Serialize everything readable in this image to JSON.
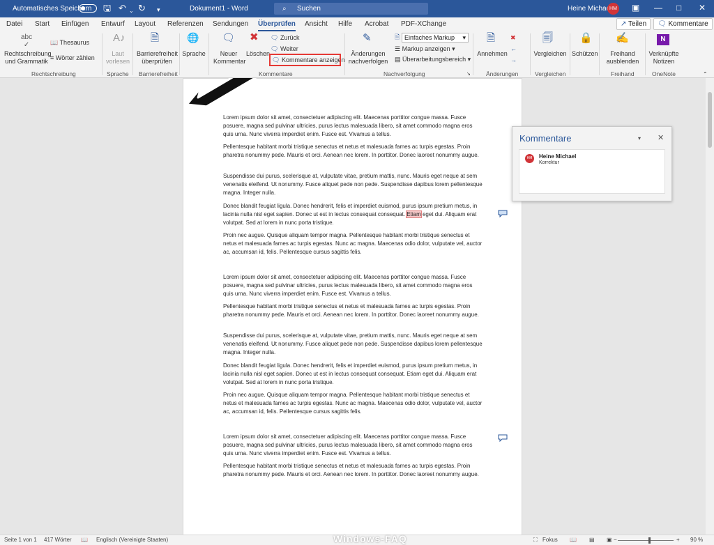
{
  "titlebar": {
    "autosave_label": "Automatisches Speichern",
    "doc_title": "Dokument1  -  Word",
    "search_label": "Suchen",
    "user_name": "Heine Michael",
    "user_initials": "HM"
  },
  "tabs": [
    "Datei",
    "Start",
    "Einfügen",
    "Entwurf",
    "Layout",
    "Referenzen",
    "Sendungen",
    "Überprüfen",
    "Ansicht",
    "Hilfe",
    "Acrobat",
    "PDF-XChange"
  ],
  "active_tab": "Überprüfen",
  "top_buttons": {
    "share": "Teilen",
    "comments": "Kommentare"
  },
  "ribbon": {
    "spelling": "Rechtschreibung\nund Grammatik",
    "thesaurus": "Thesaurus",
    "wordcount": "Wörter zählen",
    "group_proofing": "Rechtschreibung",
    "read_aloud": "Laut\nvorlesen",
    "group_speech": "Sprache",
    "accessibility": "Barrierefreiheit\nüberprüfen",
    "group_accessibility": "Barrierefreiheit",
    "language": "Sprache",
    "group_language": "",
    "new_comment": "Neuer\nKommentar",
    "delete": "Löschen",
    "previous": "Zurück",
    "next": "Weiter",
    "show_comments": "Kommentare anzeigen",
    "group_comments": "Kommentare",
    "track_changes": "Änderungen\nnachverfolgen",
    "markup_combo": "Einfaches Markup",
    "show_markup": "Markup anzeigen",
    "reviewing_pane": "Überarbeitungsbereich",
    "group_tracking": "Nachverfolgung",
    "accept": "Annehmen",
    "group_changes": "Änderungen",
    "compare": "Vergleichen",
    "group_compare": "Vergleichen",
    "protect": "Schützen",
    "hide_ink": "Freihand\nausblenden",
    "group_ink": "Freihand",
    "linked_notes": "Verknüpfte\nNotizen",
    "group_onenote": "OneNote"
  },
  "document": {
    "paragraphs": [
      "Lorem ipsum dolor sit amet, consectetuer adipiscing elit. Maecenas porttitor congue massa. Fusce posuere, magna sed pulvinar ultricies, purus lectus malesuada libero, sit amet commodo magna eros quis urna. Nunc viverra imperdiet enim. Fusce est. Vivamus a tellus.",
      "Pellentesque habitant morbi tristique senectus et netus et malesuada fames ac turpis egestas. Proin pharetra nonummy pede. Mauris et orci. Aenean nec lorem. In porttitor. Donec laoreet nonummy augue.",
      "Suspendisse dui purus, scelerisque at, vulputate vitae, pretium mattis, nunc. Mauris eget neque at sem venenatis eleifend. Ut nonummy. Fusce aliquet pede non pede. Suspendisse dapibus lorem pellentesque magna. Integer nulla.",
      "Donec blandit feugiat ligula. Donec hendrerit, felis et imperdiet euismod, purus ipsum pretium metus, in lacinia nulla nisl eget sapien. Donec ut est in lectus consequat consequat. Etiam eget dui. Aliquam erat volutpat. Sed at lorem in nunc porta tristique.",
      "Proin nec augue. Quisque aliquam tempor magna. Pellentesque habitant morbi tristique senectus et netus et malesuada fames ac turpis egestas. Nunc ac magna. Maecenas odio dolor, vulputate vel, auctor ac, accumsan id, felis. Pellentesque cursus sagittis felis."
    ],
    "highlight_word": "Etiam"
  },
  "comments_panel": {
    "title": "Kommentare",
    "author": "Heine Michael",
    "author_initials": "HM",
    "text": "Korrektur"
  },
  "status": {
    "page": "Seite 1 von 1",
    "words": "417 Wörter",
    "language": "Englisch (Vereinigte Staaten)",
    "focus": "Fokus",
    "zoom": "90 %"
  },
  "watermark": "Windows-FAQ",
  "colors": {
    "accent": "#2b579a",
    "highlight_box": "#e53935",
    "avatar": "#d13438"
  }
}
